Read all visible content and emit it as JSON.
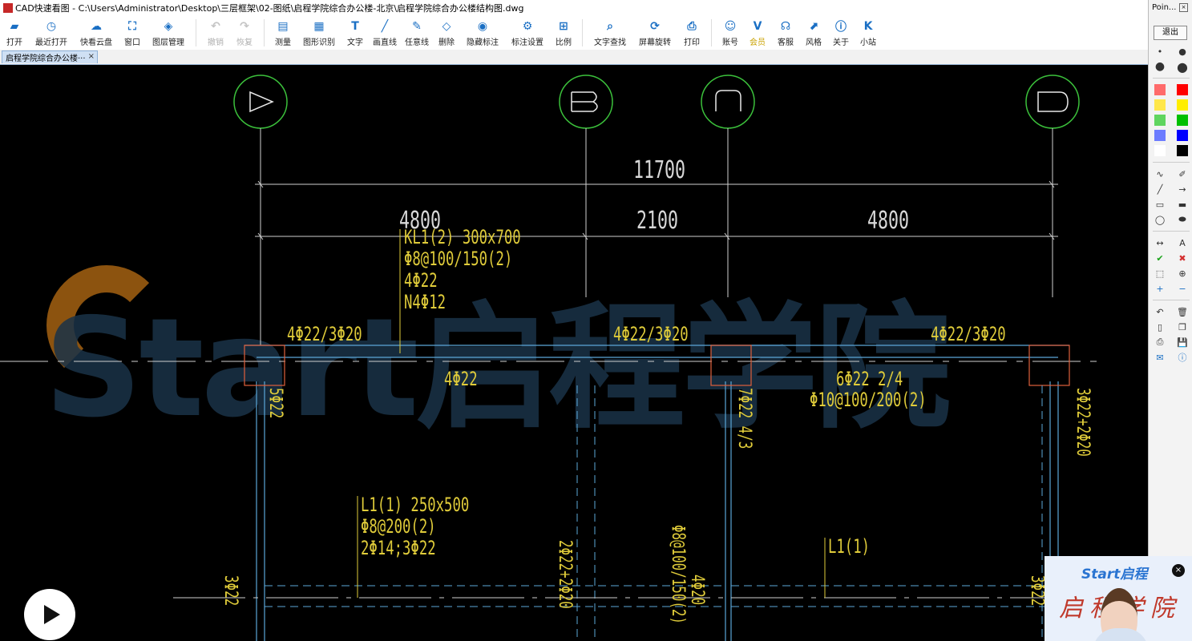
{
  "window": {
    "title": "CAD快速看图 - C:\\Users\\Administrator\\Desktop\\三层框架\\02-图纸\\启程学院综合办公楼-北京\\启程学院综合办公楼结构图.dwg"
  },
  "toolbar": {
    "items": [
      {
        "label": "打开",
        "icon": "folder-open-icon",
        "glyph": "▰"
      },
      {
        "label": "最近打开",
        "icon": "clock-icon",
        "glyph": "◷"
      },
      {
        "label": "快看云盘",
        "icon": "cloud-icon",
        "glyph": "☁"
      },
      {
        "label": "窗口",
        "icon": "window-icon",
        "glyph": "⛶"
      },
      {
        "label": "图层管理",
        "icon": "layers-icon",
        "glyph": "◈"
      },
      {
        "label": "撤销",
        "icon": "undo-icon",
        "glyph": "↶",
        "disabled": true
      },
      {
        "label": "恢复",
        "icon": "redo-icon",
        "glyph": "↷",
        "disabled": true
      },
      {
        "label": "测量",
        "icon": "ruler-icon",
        "glyph": "▤"
      },
      {
        "label": "图形识别",
        "icon": "shape-recognition-icon",
        "glyph": "▦"
      },
      {
        "label": "文字",
        "icon": "text-icon",
        "glyph": "T"
      },
      {
        "label": "画直线",
        "icon": "line-icon",
        "glyph": "╱"
      },
      {
        "label": "任意线",
        "icon": "pen-icon",
        "glyph": "✎"
      },
      {
        "label": "删除",
        "icon": "eraser-icon",
        "glyph": "◇"
      },
      {
        "label": "隐藏标注",
        "icon": "eye-hidden-icon",
        "glyph": "◉"
      },
      {
        "label": "标注设置",
        "icon": "annotation-settings-icon",
        "glyph": "⚙"
      },
      {
        "label": "比例",
        "icon": "scale-icon",
        "glyph": "⊞"
      },
      {
        "label": "文字查找",
        "icon": "find-text-icon",
        "glyph": "⌕"
      },
      {
        "label": "屏幕旋转",
        "icon": "rotate-screen-icon",
        "glyph": "⟳"
      },
      {
        "label": "打印",
        "icon": "print-icon",
        "glyph": "⎙"
      },
      {
        "label": "账号",
        "icon": "user-icon",
        "glyph": "☺"
      },
      {
        "label": "会员",
        "icon": "vip-icon",
        "glyph": "V",
        "vip": true
      },
      {
        "label": "客服",
        "icon": "headset-icon",
        "glyph": "☊"
      },
      {
        "label": "风格",
        "icon": "style-icon",
        "glyph": "⬈"
      },
      {
        "label": "关于",
        "icon": "info-icon",
        "glyph": "ⓘ"
      },
      {
        "label": "小站",
        "icon": "k-site-icon",
        "glyph": "K"
      }
    ]
  },
  "tabs": {
    "doc_tab": "启程学院综合办公楼···",
    "close": "×"
  },
  "drawing": {
    "grid_axes": [
      {
        "label": "A"
      },
      {
        "label": "B"
      },
      {
        "label": "C"
      },
      {
        "label": "D"
      }
    ],
    "dims": {
      "total": "11700",
      "spans": [
        "4800",
        "2100",
        "4800"
      ]
    },
    "beam_kl": {
      "name": "KL1(2) 300x700",
      "stirrup": "Φ8@100/150(2)",
      "top": "4Φ22",
      "side": "N4Φ12"
    },
    "support_rebar": [
      "4Φ22/3Φ20",
      "4Φ22/3Φ20",
      "4Φ22/3Φ20"
    ],
    "bottom_rebar_1": "4Φ22",
    "bottom_rebar_2": "6Φ22 2/4",
    "stirrup_2": "Φ10@100/200(2)",
    "beam_l": {
      "name": "L1(1) 250x500",
      "stirrup": "Φ8@200(2)",
      "rebar": "2Φ14;3Φ22"
    },
    "l1_label": "L1(1)",
    "vertical_labels": {
      "a": "5Φ22",
      "b": "7Φ22 4/3",
      "c": "3Φ22+2Φ20",
      "d": "3Φ22",
      "e": "2Φ22+2Φ20",
      "f": "Φ8@100/150(2)",
      "g": "4Φ20",
      "h": "3Φ22"
    },
    "watermark": "Start启程学院"
  },
  "palette": {
    "title": "Poin...",
    "exit": "退出",
    "colors": [
      "#ff6b6b",
      "#ff0000",
      "#ffe74a",
      "#ffee00",
      "#5fd55f",
      "#00c000",
      "#6c7cff",
      "#0000ff",
      "#ffffff",
      "#000000"
    ],
    "tools": [
      {
        "icon": "freehand-icon",
        "glyph": "∿"
      },
      {
        "icon": "highlighter-icon",
        "glyph": "✐"
      },
      {
        "icon": "line-tool-icon",
        "glyph": "╱"
      },
      {
        "icon": "arrow-tool-icon",
        "glyph": "→"
      },
      {
        "icon": "rectangle-tool-icon",
        "glyph": "▭"
      },
      {
        "icon": "filled-rectangle-tool-icon",
        "glyph": "▬"
      },
      {
        "icon": "ellipse-tool-icon",
        "glyph": "◯"
      },
      {
        "icon": "filled-ellipse-tool-icon",
        "glyph": "⬬"
      },
      {
        "icon": "double-arrow-tool-icon",
        "glyph": "↔"
      },
      {
        "icon": "text-tool-icon",
        "glyph": "A"
      },
      {
        "icon": "check-icon",
        "glyph": "✔"
      },
      {
        "icon": "cross-icon",
        "glyph": "✖"
      },
      {
        "icon": "select-area-icon",
        "glyph": "⬚"
      },
      {
        "icon": "zoom-area-icon",
        "glyph": "⊕"
      },
      {
        "icon": "plus-icon",
        "glyph": "+"
      },
      {
        "icon": "minus-icon",
        "glyph": "−"
      },
      {
        "icon": "undo-tool-icon",
        "glyph": "↶"
      },
      {
        "icon": "trash-icon",
        "glyph": "🗑"
      },
      {
        "icon": "new-page-icon",
        "glyph": "▯"
      },
      {
        "icon": "copy-icon",
        "glyph": "❐"
      },
      {
        "icon": "print-tool-icon",
        "glyph": "⎙"
      },
      {
        "icon": "save-icon",
        "glyph": "💾"
      },
      {
        "icon": "mail-icon",
        "glyph": "✉"
      },
      {
        "icon": "help-icon",
        "glyph": "ⓘ"
      }
    ]
  },
  "overlay": {
    "brand": "Start启程",
    "calligraphy": "启程学院",
    "close": "×"
  }
}
